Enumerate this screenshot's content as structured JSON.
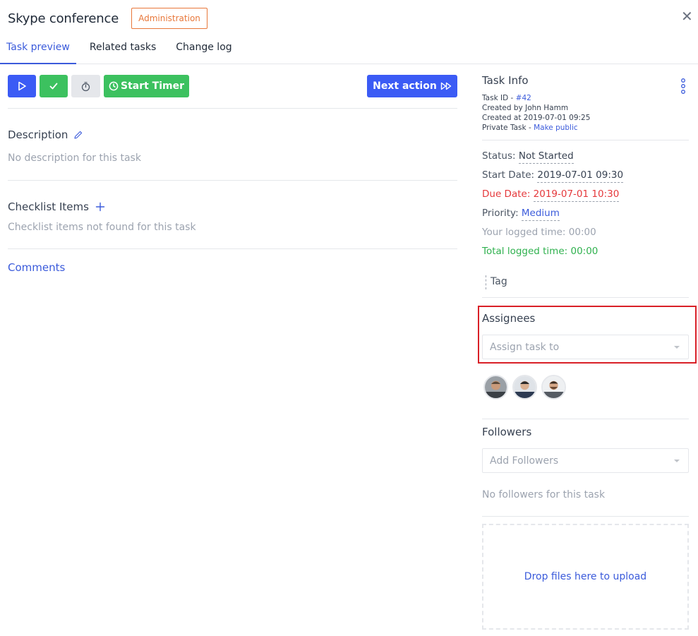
{
  "header": {
    "title": "Skype conference",
    "badge": "Administration",
    "close_glyph": "✕"
  },
  "tabs": [
    {
      "label": "Task preview",
      "active": true
    },
    {
      "label": "Related tasks",
      "active": false
    },
    {
      "label": "Change log",
      "active": false
    }
  ],
  "toolbar": {
    "start_timer_label": "Start Timer",
    "next_action_label": "Next action"
  },
  "description": {
    "heading": "Description",
    "empty_text": "No description for this task"
  },
  "checklist": {
    "heading": "Checklist Items",
    "empty_text": "Checklist items not found for this task"
  },
  "comments": {
    "label": "Comments"
  },
  "task_info": {
    "title": "Task Info",
    "task_id_label": "Task ID - ",
    "task_id_value": "#42",
    "created_by": "Created by John Hamm",
    "created_at": "Created at 2019-07-01 09:25",
    "private_label": "Private Task - ",
    "private_value": "Make public"
  },
  "properties": {
    "status_label": "Status: ",
    "status_value": "Not Started",
    "start_label": "Start Date: ",
    "start_value": "2019-07-01 09:30",
    "due_label": "Due Date: ",
    "due_value": "2019-07-01 10:30",
    "priority_label": "Priority: ",
    "priority_value": "Medium",
    "your_logged": "Your logged time: 00:00",
    "total_logged": "Total logged time: 00:00"
  },
  "tag": {
    "placeholder": "Tag"
  },
  "assignees": {
    "heading": "Assignees",
    "placeholder": "Assign task to",
    "avatars": [
      "avatar-1",
      "avatar-2",
      "avatar-3"
    ]
  },
  "followers": {
    "heading": "Followers",
    "placeholder": "Add Followers",
    "empty_text": "No followers for this task"
  },
  "dropzone": {
    "label": "Drop files here to upload"
  },
  "colors": {
    "primary": "#3b5bf5",
    "success": "#3cc15f",
    "danger": "#e5383b",
    "badge": "#e8773a",
    "highlight": "#d92027"
  }
}
